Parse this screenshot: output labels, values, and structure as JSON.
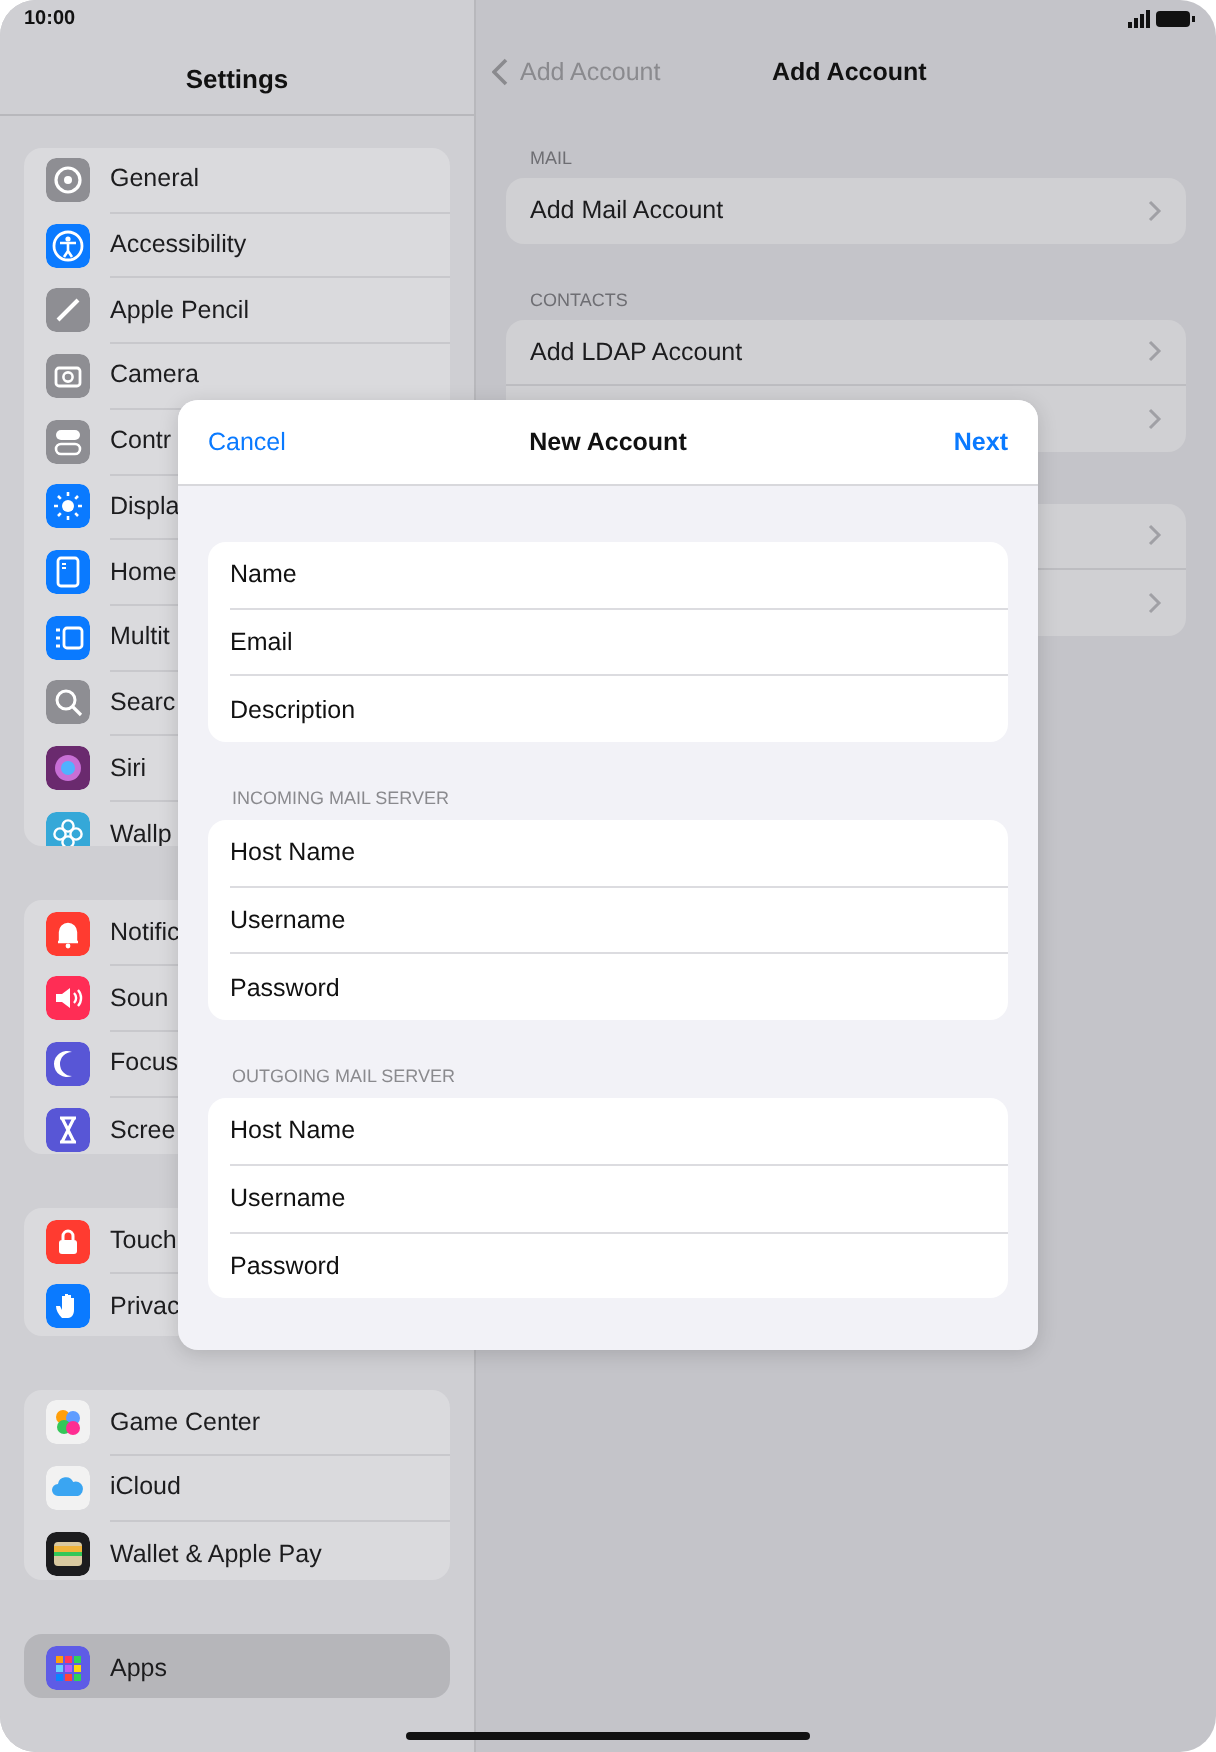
{
  "status_bar": {
    "time": "10:00"
  },
  "sidebar": {
    "title": "Settings",
    "groups": [
      [
        {
          "label": "General",
          "color": "#8e8e93",
          "selected": false
        },
        {
          "label": "Accessibility",
          "color": "#0a7aff",
          "selected": false
        },
        {
          "label": "Apple Pencil",
          "color": "#8e8e93",
          "selected": false
        },
        {
          "label": "Camera",
          "color": "#8e8e93",
          "selected": false
        },
        {
          "label": "Contr",
          "color": "#8e8e93",
          "selected": false
        },
        {
          "label": "Displa",
          "color": "#0a7aff",
          "selected": false
        },
        {
          "label": "Home",
          "color": "#0a7aff",
          "selected": false
        },
        {
          "label": "Multit",
          "color": "#0a7aff",
          "selected": false
        },
        {
          "label": "Searc",
          "color": "#8e8e93",
          "selected": false
        },
        {
          "label": "Siri",
          "color": "#6a2a6e",
          "selected": false
        },
        {
          "label": "Wallp",
          "color": "#35a8d8",
          "selected": false
        }
      ],
      [
        {
          "label": "Notific",
          "color": "#ff3b30",
          "selected": false
        },
        {
          "label": "Soun",
          "color": "#ff2d55",
          "selected": false
        },
        {
          "label": "Focus",
          "color": "#5856d6",
          "selected": false
        },
        {
          "label": "Scree",
          "color": "#5856d6",
          "selected": false
        }
      ],
      [
        {
          "label": "Touch",
          "color": "#ff3b30",
          "selected": false
        },
        {
          "label": "Privac",
          "color": "#0a7aff",
          "selected": false
        }
      ],
      [
        {
          "label": "Game Center",
          "color": "#f2f2f2",
          "selected": false
        },
        {
          "label": "iCloud",
          "color": "#f2f2f2",
          "selected": false
        },
        {
          "label": "Wallet & Apple Pay",
          "color": "#1c1c1e",
          "selected": false
        }
      ],
      [
        {
          "label": "Apps",
          "color": "#5e5ce6",
          "selected": true
        }
      ]
    ]
  },
  "detail": {
    "back": "Add Account",
    "title": "Add Account",
    "sections": [
      {
        "header": "MAIL",
        "rows": [
          {
            "kind": "labeled",
            "label": "Add Mail Account"
          }
        ]
      },
      {
        "header": "CONTACTS",
        "rows": [
          {
            "kind": "labeled",
            "label": "Add LDAP Account"
          },
          {
            "kind": "covered"
          }
        ]
      },
      {
        "rows": [
          {
            "kind": "covered"
          },
          {
            "kind": "covered"
          }
        ]
      }
    ]
  },
  "sheet": {
    "cancel": "Cancel",
    "title": "New Account",
    "next": "Next",
    "groups": [
      {
        "fields": [
          "Name",
          "Email",
          "Description"
        ]
      },
      {
        "header": "INCOMING MAIL SERVER",
        "fields": [
          "Host Name",
          "Username",
          "Password"
        ]
      },
      {
        "header": "OUTGOING MAIL SERVER",
        "fields": [
          "Host Name",
          "Username",
          "Password"
        ]
      }
    ]
  }
}
